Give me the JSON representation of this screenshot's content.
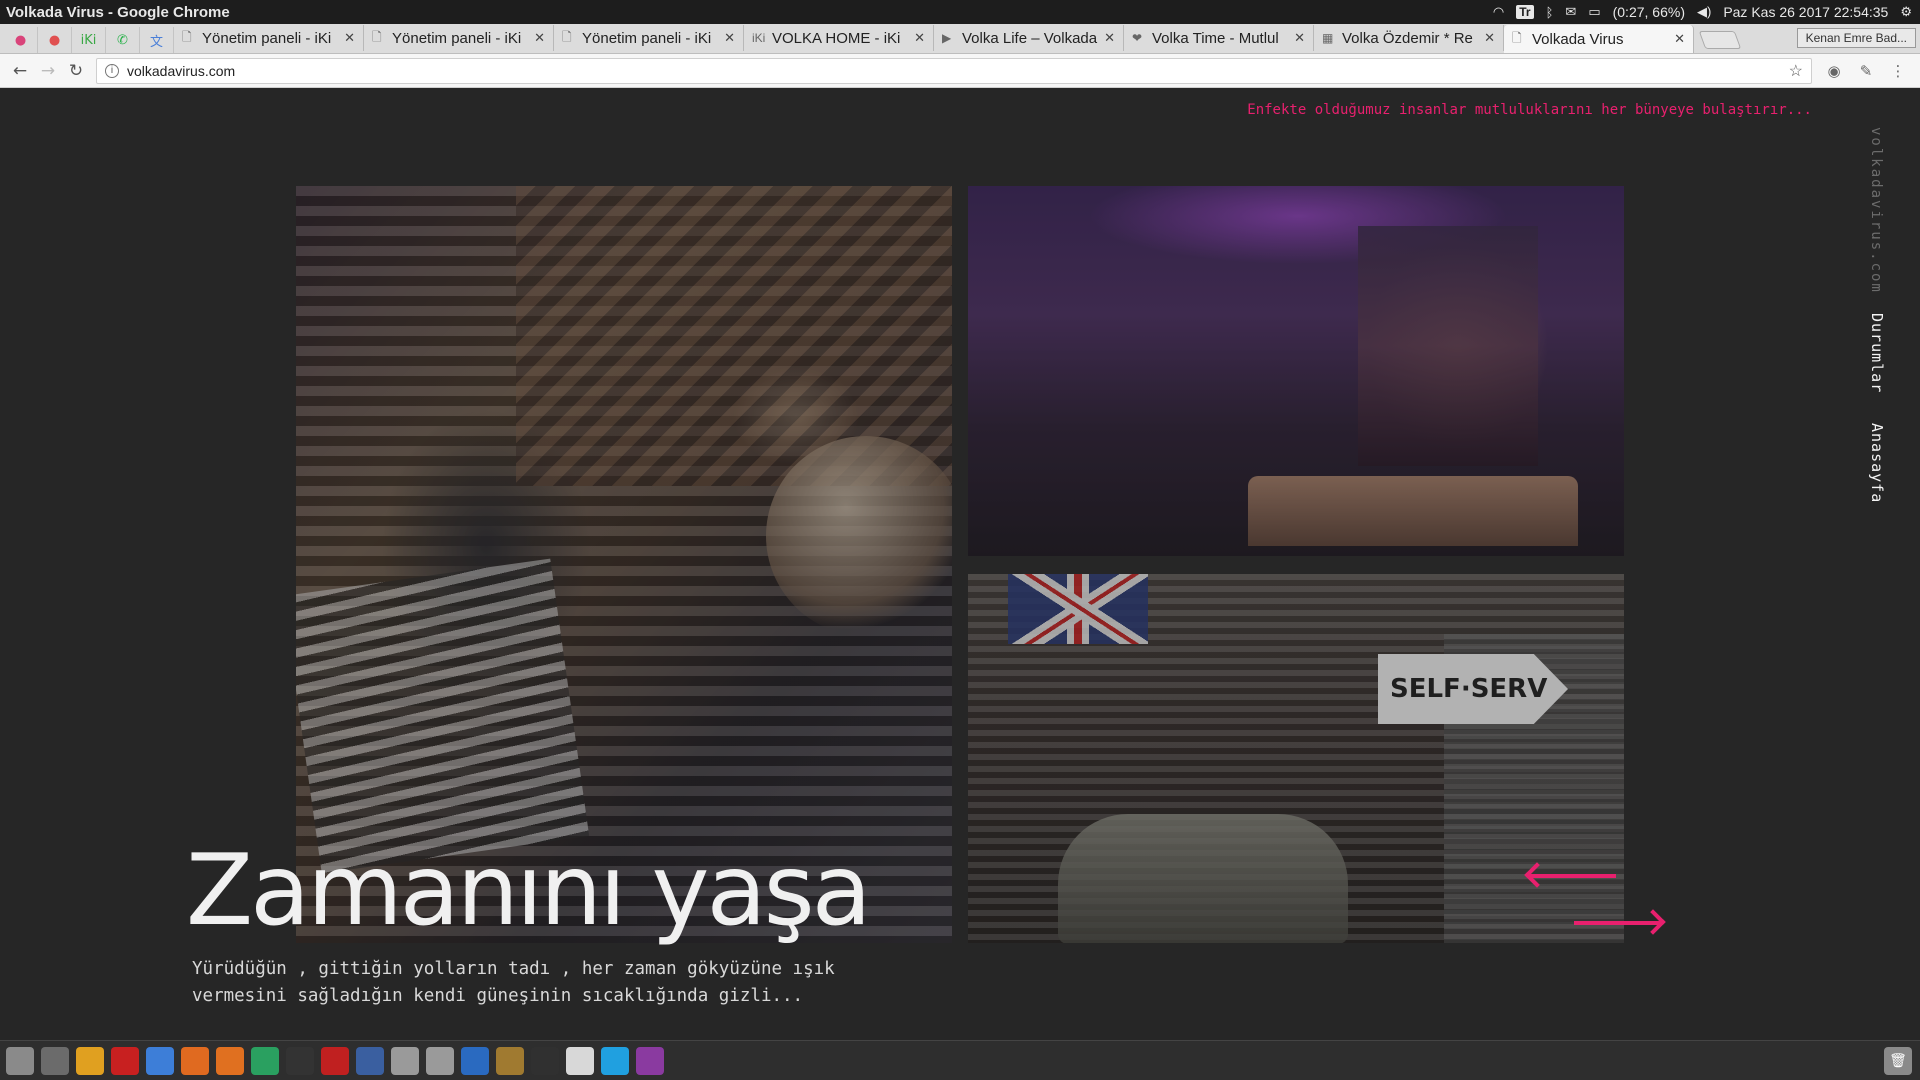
{
  "window": {
    "title": "Volkada Virus - Google Chrome"
  },
  "system_tray": {
    "keyboard": "Tr",
    "battery": "(0:27, 66%)",
    "datetime": "Paz Kas 26 2017 22:54:35"
  },
  "browser": {
    "pinned_tabs": [
      {
        "icon": "app-icon",
        "glyph": "●",
        "color": "#d9447a"
      },
      {
        "icon": "app-icon",
        "glyph": "●",
        "color": "#e05050"
      },
      {
        "icon": "iki-icon",
        "glyph": "iKi",
        "color": "#3aa845"
      },
      {
        "icon": "whatsapp-icon",
        "glyph": "✆",
        "color": "#2bb24c"
      },
      {
        "icon": "translate-icon",
        "glyph": "文",
        "color": "#4a7fd8"
      }
    ],
    "tabs": [
      {
        "title": "Yönetim paneli - iKi",
        "icon": "page-icon",
        "glyph": "🗋"
      },
      {
        "title": "Yönetim paneli - iKi",
        "icon": "page-icon",
        "glyph": "🗋"
      },
      {
        "title": "Yönetim paneli - iKi",
        "icon": "page-icon",
        "glyph": "🗋"
      },
      {
        "title": "VOLKA HOME - iKi",
        "icon": "iki-icon",
        "glyph": "iKi"
      },
      {
        "title": "Volka Life – Volkada",
        "icon": "volka-life-icon",
        "glyph": "▶"
      },
      {
        "title": "Volka Time - Mutlul",
        "icon": "heart-icon",
        "glyph": "❤"
      },
      {
        "title": "Volka Özdemir * Re",
        "icon": "site-icon",
        "glyph": "▦"
      },
      {
        "title": "Volkada Virus",
        "icon": "page-icon",
        "glyph": "🗋",
        "active": true
      }
    ],
    "profile_button": "Kenan Emre Bad...",
    "url": "volkadavirus.com"
  },
  "page": {
    "tagline": "Enfekte olduğumuz insanlar mutluluklarını her bünyeye bulaştırır...",
    "side_domain": "volkadavirus.com",
    "side_links": [
      "Durumlar",
      "Anasayfa"
    ],
    "headline": "Zamanını yaşa",
    "subtext": "Yürüdüğün , gittiğin yolların tadı , her zaman gökyüzüne ışık vermesini sağladığın kendi güneşinin sıcaklığında gizli...",
    "photo_3_sign": "SELF·SERV",
    "accent_color": "#e8206e"
  },
  "taskbar": {
    "apps": [
      {
        "icon": "ubuntu-icon",
        "color": "#8a8a8a"
      },
      {
        "icon": "files-icon",
        "color": "#6b6b6b"
      },
      {
        "icon": "chrome-icon",
        "color": "#e0a020"
      },
      {
        "icon": "opera-icon",
        "color": "#c82020"
      },
      {
        "icon": "chromium-icon",
        "color": "#3d7ed8"
      },
      {
        "icon": "firefox-icon",
        "color": "#e06a20"
      },
      {
        "icon": "settings-icon",
        "color": "#e07020"
      },
      {
        "icon": "network-icon",
        "color": "#2aa060"
      },
      {
        "icon": "terminal-icon",
        "color": "#333333"
      },
      {
        "icon": "filezilla-icon",
        "color": "#c02020"
      },
      {
        "icon": "remote-icon",
        "color": "#3a5fa0"
      },
      {
        "icon": "drive-icon",
        "color": "#9a9a9a"
      },
      {
        "icon": "drive-icon",
        "color": "#9a9a9a"
      },
      {
        "icon": "thunderbird-icon",
        "color": "#2a6ac0"
      },
      {
        "icon": "archive-icon",
        "color": "#a07a30"
      },
      {
        "icon": "video-icon",
        "color": "#303030"
      },
      {
        "icon": "text-editor-icon",
        "color": "#d8d8d8"
      },
      {
        "icon": "skype-icon",
        "color": "#20a0e0"
      },
      {
        "icon": "window-icon",
        "color": "#8a3aa0"
      }
    ]
  }
}
